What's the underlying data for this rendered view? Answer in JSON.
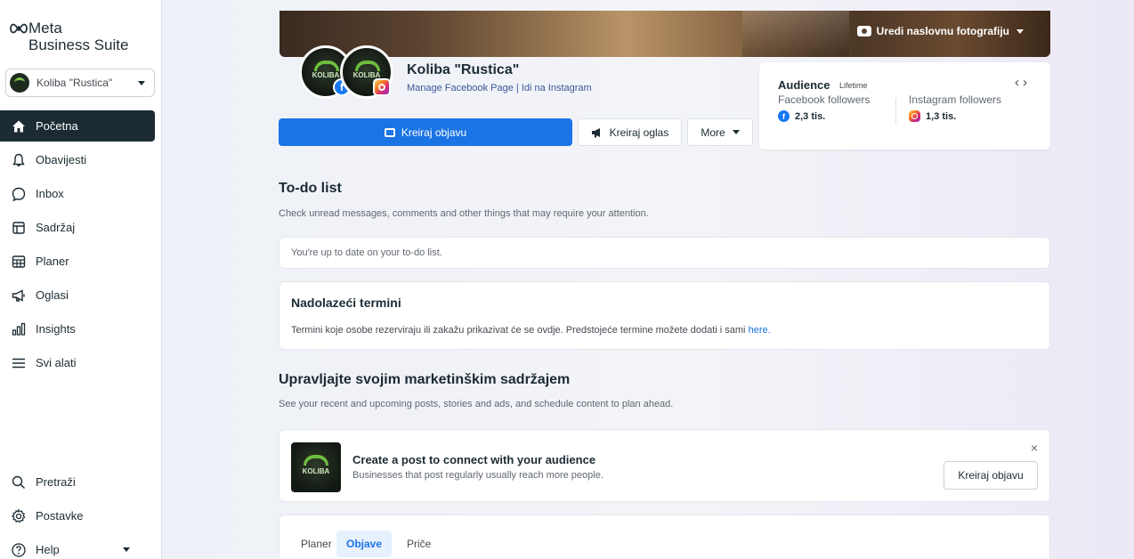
{
  "brand": {
    "line1": "Meta",
    "line2": "Business Suite"
  },
  "account": {
    "name": "Koliba \"Rustica\""
  },
  "nav": [
    {
      "label": "Početna",
      "icon": "home-icon",
      "active": true
    },
    {
      "label": "Obavijesti",
      "icon": "bell-icon"
    },
    {
      "label": "Inbox",
      "icon": "chat-bubble-icon"
    },
    {
      "label": "Sadržaj",
      "icon": "content-icon"
    },
    {
      "label": "Planer",
      "icon": "calendar-icon"
    },
    {
      "label": "Oglasi",
      "icon": "megaphone-icon"
    },
    {
      "label": "Insights",
      "icon": "bar-chart-icon"
    },
    {
      "label": "Svi alati",
      "icon": "menu-icon"
    }
  ],
  "nav_bottom": [
    {
      "label": "Pretraži",
      "icon": "search-icon"
    },
    {
      "label": "Postavke",
      "icon": "gear-icon"
    },
    {
      "label": "Help",
      "icon": "help-circle-icon"
    }
  ],
  "cover": {
    "edit_label": "Uredi naslovnu fotografiju"
  },
  "page": {
    "name": "Koliba \"Rustica\"",
    "links": "Manage Facebook Page | Idi na Instagram",
    "avatar_text": "KOLIBA"
  },
  "actions": {
    "create_post": "Kreiraj objavu",
    "create_ad": "Kreiraj oglas",
    "more": "More"
  },
  "audience": {
    "title": "Audience",
    "subtitle": "Lifetime",
    "fb_label": "Facebook followers",
    "fb_value": "2,3 tis.",
    "ig_label": "Instagram followers",
    "ig_value": "1,3 tis."
  },
  "todo": {
    "title": "To-do list",
    "subtitle": "Check unread messages, comments and other things that may require your attention.",
    "status": "You're up to date on your to-do list."
  },
  "appointments": {
    "title": "Nadolazeći termini",
    "desc": "Termini koje osobe rezerviraju ili zakažu prikazivat će se ovdje. Predstojeće termine možete dodati i sami",
    "link": "here."
  },
  "marketing": {
    "title": "Upravljajte svojim marketinškim sadržajem",
    "subtitle": "See your recent and upcoming posts, stories and ads, and schedule content to plan ahead."
  },
  "post_prompt": {
    "title": "Create a post to connect with your audience",
    "subtitle": "Businesses that post regularly usually reach more people.",
    "button": "Kreiraj objavu",
    "close": "×"
  },
  "tabs": [
    {
      "label": "Planer"
    },
    {
      "label": "Objave",
      "active": true
    },
    {
      "label": "Priče"
    }
  ],
  "colors": {
    "primary": "#1b74e4",
    "sidebar_active": "#1c2b33",
    "facebook": "#1877f2"
  }
}
